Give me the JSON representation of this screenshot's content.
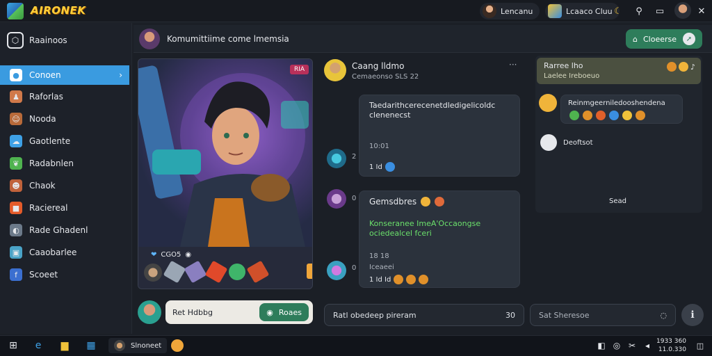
{
  "app": {
    "logo_text": "AIRONEK"
  },
  "topbar": {
    "user1_label": "Lencanu",
    "user2_label": "Lcaaco Cluu",
    "icons": [
      "moon-icon",
      "bell-icon",
      "chat-icon",
      "avatar-icon",
      "close-icon"
    ]
  },
  "sidebar": {
    "header": "Raainoos",
    "items": [
      {
        "label": "Conoen",
        "icon": "home-icon",
        "color": "#3a9be0"
      },
      {
        "label": "Raforlas",
        "icon": "person-icon",
        "color": "#d0794a"
      },
      {
        "label": "Nooda",
        "icon": "character-icon",
        "color": "#b86a3a"
      },
      {
        "label": "Gaotlente",
        "icon": "cloud-icon",
        "color": "#3ea1e6"
      },
      {
        "label": "Radabnlen",
        "icon": "leaf-icon",
        "color": "#4fb34f"
      },
      {
        "label": "Chaok",
        "icon": "hero-icon",
        "color": "#c0623b"
      },
      {
        "label": "Raciereal",
        "icon": "badge-icon",
        "color": "#e45b2a"
      },
      {
        "label": "Rade Ghadenl",
        "icon": "helmet-icon",
        "color": "#6c7a8a"
      },
      {
        "label": "Caaobarlee",
        "icon": "box-icon",
        "color": "#4aa3c7"
      },
      {
        "label": "Scoeet",
        "icon": "facebook-icon",
        "color": "#3b6fd0"
      }
    ]
  },
  "chat": {
    "title": "Komumittiime come lmemsia",
    "header_button": "Cloeerse",
    "card_badge": "RIA",
    "card_label": "CGO5",
    "contact_name": "Caang lldmo",
    "contact_status": "Cemaeonso SLS 22",
    "msg1_text": "Taedarithcerecenetdledigelicoldc clenenecst",
    "msg1_time": "10:01",
    "msg1_meta": "1 Id",
    "msg1_num": "2",
    "msg2_title": "Gemsdbres",
    "msg2_text": "Konseranee ImeA'Occaongse ociedealcel fceri",
    "msg2_time": "18 18",
    "msg2_sub": "Iceaeei",
    "msg2_meta": "1 Id Id",
    "msg2_num": "0",
    "msg3_num": "0",
    "reply_label": "Ret Hdbbg",
    "reply_button": "Roaes",
    "message_placeholder": "Ratl obedeep pireram",
    "message_count": "30"
  },
  "rightcol": {
    "notice_title": "Rarree lho",
    "notice_sub": "Laelee Ireboeuo",
    "reaction_text": "Reinmgeerniledooshendena",
    "user_label": "Deoftsot",
    "footer": "Sead",
    "search_placeholder": "Sat Sheresoe"
  },
  "taskbar": {
    "app_label": "Slnoneet",
    "time": "1933 360",
    "date": "11.0.330"
  }
}
